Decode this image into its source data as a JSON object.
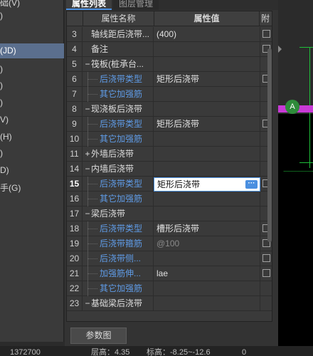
{
  "left_panel": {
    "items": [
      {
        "label": "础(V)",
        "selected": false
      },
      {
        "label": ")",
        "selected": false
      },
      {
        "label": "",
        "selected": false
      },
      {
        "label": "(JD)",
        "selected": true
      },
      {
        "label": ")",
        "selected": false
      },
      {
        "label": ")",
        "selected": false
      },
      {
        "label": ")",
        "selected": false
      },
      {
        "label": "V)",
        "selected": false
      },
      {
        "label": "(H)",
        "selected": false
      },
      {
        "label": ")",
        "selected": false
      },
      {
        "label": "D)",
        "selected": false
      },
      {
        "label": "手(G)",
        "selected": false
      }
    ]
  },
  "tabs": {
    "active": "属性列表",
    "inactive": "图层管理"
  },
  "table": {
    "headers": {
      "name": "属性名称",
      "value": "属性值",
      "attach": "附"
    },
    "rows": [
      {
        "num": "3",
        "sign": "",
        "name": "轴线距后浇带...",
        "value": "(400)",
        "child": false,
        "muted": false,
        "checkbox": true
      },
      {
        "num": "4",
        "sign": "",
        "name": "备注",
        "value": "",
        "child": false,
        "muted": false,
        "checkbox": true
      },
      {
        "num": "5",
        "sign": "−",
        "name": "筏板(桩承台...",
        "value": "",
        "child": false,
        "muted": false,
        "checkbox": false
      },
      {
        "num": "6",
        "sign": "",
        "name": "后浇带类型",
        "value": "矩形后浇带",
        "child": true,
        "muted": false,
        "checkbox": true
      },
      {
        "num": "7",
        "sign": "",
        "name": "其它加强筋",
        "value": "",
        "child": true,
        "muted": false,
        "checkbox": false
      },
      {
        "num": "8",
        "sign": "−",
        "name": "现浇板后浇带",
        "value": "",
        "child": false,
        "muted": false,
        "checkbox": false
      },
      {
        "num": "9",
        "sign": "",
        "name": "后浇带类型",
        "value": "矩形后浇带",
        "child": true,
        "muted": false,
        "checkbox": true
      },
      {
        "num": "10",
        "sign": "",
        "name": "其它加强筋",
        "value": "",
        "child": true,
        "muted": false,
        "checkbox": false
      },
      {
        "num": "11",
        "sign": "+",
        "name": "外墙后浇带",
        "value": "",
        "child": false,
        "muted": false,
        "checkbox": false
      },
      {
        "num": "14",
        "sign": "−",
        "name": "内墙后浇带",
        "value": "",
        "child": false,
        "muted": false,
        "checkbox": false
      },
      {
        "num": "15",
        "sign": "",
        "name": "后浇带类型",
        "value": "矩形后浇带",
        "child": true,
        "muted": false,
        "checkbox": true,
        "editing": true
      },
      {
        "num": "16",
        "sign": "",
        "name": "其它加强筋",
        "value": "",
        "child": true,
        "muted": false,
        "checkbox": false
      },
      {
        "num": "17",
        "sign": "−",
        "name": "梁后浇带",
        "value": "",
        "child": false,
        "muted": false,
        "checkbox": false
      },
      {
        "num": "18",
        "sign": "",
        "name": "后浇带类型",
        "value": "槽形后浇带",
        "child": true,
        "muted": false,
        "checkbox": true
      },
      {
        "num": "19",
        "sign": "",
        "name": "后浇带箍筋",
        "value": "@100",
        "child": true,
        "muted": true,
        "checkbox": true
      },
      {
        "num": "20",
        "sign": "",
        "name": "后浇带侧...",
        "value": "",
        "child": true,
        "muted": false,
        "checkbox": true
      },
      {
        "num": "21",
        "sign": "",
        "name": "加强筋伸...",
        "value": "lae",
        "child": true,
        "muted": false,
        "checkbox": true
      },
      {
        "num": "22",
        "sign": "",
        "name": "其它加强筋",
        "value": "",
        "child": true,
        "muted": false,
        "checkbox": false
      },
      {
        "num": "23",
        "sign": "−",
        "name": "基础梁后浇带",
        "value": "",
        "child": false,
        "muted": false,
        "checkbox": false
      }
    ],
    "active_row_num": "15",
    "edit_button_label": "···"
  },
  "param_button_label": "参数图",
  "canvas": {
    "marker_label": "A"
  },
  "status_bar": {
    "items": [
      "1372700",
      "层高：4.35",
      "标高：-8.25~-12.6",
      "0"
    ]
  },
  "colors": {
    "selected_bg": "#5b6f8e",
    "child_text": "#5f9be6",
    "accent": "#4a8fe0",
    "magenta": "#c83ad6",
    "green": "#1fbf3a"
  }
}
